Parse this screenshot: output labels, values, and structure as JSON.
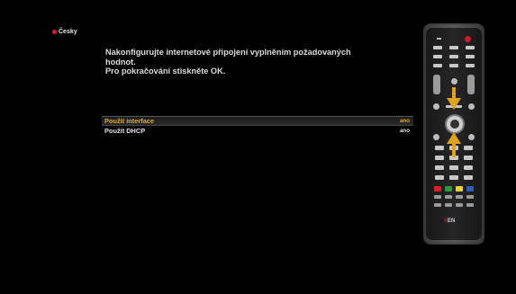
{
  "language": {
    "label": "Česky",
    "flag_color": "#d8202a"
  },
  "instructions": [
    "Nakonfigurujte internetové připojení vyplněním požadovaných",
    "hodnot.",
    "Pro pokračování stiskněte OK."
  ],
  "settings": [
    {
      "label": "Použít interface",
      "value": "ano",
      "selected": true
    },
    {
      "label": "Použít DHCP",
      "value": "ano",
      "selected": false
    }
  ],
  "remote": {
    "brand_prefix": "X",
    "brand_suffix": "EN",
    "highlight_arrows": [
      "arrow-down",
      "arrow-up"
    ],
    "color_buttons": [
      "#d8202a",
      "#2f9a3a",
      "#e6d23a",
      "#2d5fb8"
    ],
    "accent_color": "#e0a020"
  }
}
